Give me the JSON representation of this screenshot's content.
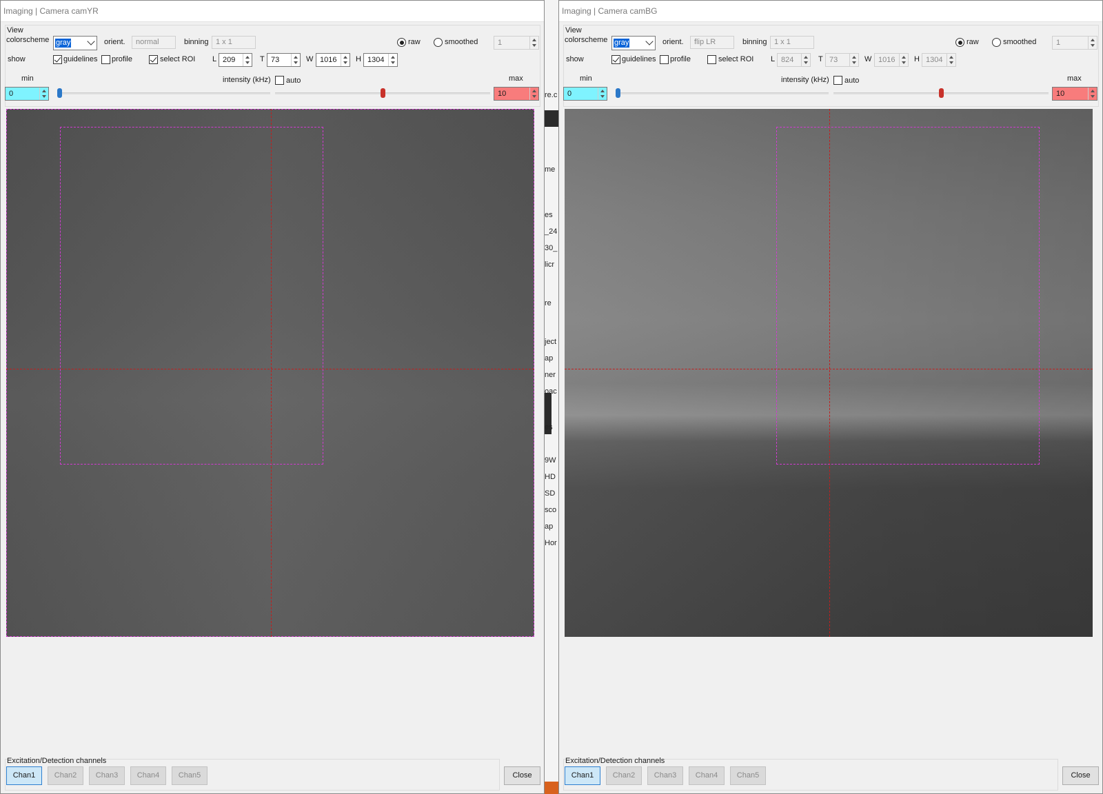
{
  "background_strip": {
    "items": [
      "re.c",
      "me",
      "es",
      "_24",
      "30_",
      "licr",
      "re",
      "ject",
      "ap",
      "ner",
      "oac",
      "es",
      "9W",
      "HD",
      "SD",
      "sco",
      "ap",
      "Hor"
    ]
  },
  "windows": [
    {
      "title": "Imaging | Camera camYR",
      "view_label": "View",
      "colorscheme_label": "colorscheme",
      "colorscheme_value": "gray",
      "orient_label": "orient.",
      "orient_value": "normal",
      "binning_label": "binning",
      "binning_value": "1 x 1",
      "raw_label": "raw",
      "smoothed_label": "smoothed",
      "smooth_value": "1",
      "raw_selected": true,
      "show_label": "show",
      "guidelines_label": "guidelines",
      "guidelines_checked": true,
      "profile_label": "profile",
      "profile_checked": false,
      "select_roi_label": "select ROI",
      "select_roi_checked": true,
      "roi": {
        "L_label": "L",
        "L": "209",
        "T_label": "T",
        "T": "73",
        "W_label": "W",
        "W": "1016",
        "H_label": "H",
        "H": "1304",
        "enabled": true
      },
      "min_label": "min",
      "max_label": "max",
      "intensity_label": "intensity (kHz)",
      "auto_label": "auto",
      "auto_checked": false,
      "min_value": "0",
      "max_value": "10",
      "channels_label": "Excitation/Detection channels",
      "channels": [
        "Chan1",
        "Chan2",
        "Chan3",
        "Chan4",
        "Chan5"
      ],
      "active_channel": "Chan1",
      "close_label": "Close"
    },
    {
      "title": "Imaging | Camera camBG",
      "view_label": "View",
      "colorscheme_label": "colorscheme",
      "colorscheme_value": "gray",
      "orient_label": "orient.",
      "orient_value": "flip LR",
      "binning_label": "binning",
      "binning_value": "1 x 1",
      "raw_label": "raw",
      "smoothed_label": "smoothed",
      "smooth_value": "1",
      "raw_selected": true,
      "show_label": "show",
      "guidelines_label": "guidelines",
      "guidelines_checked": true,
      "profile_label": "profile",
      "profile_checked": false,
      "select_roi_label": "select ROI",
      "select_roi_checked": false,
      "roi": {
        "L_label": "L",
        "L": "824",
        "T_label": "T",
        "T": "73",
        "W_label": "W",
        "W": "1016",
        "H_label": "H",
        "H": "1304",
        "enabled": false
      },
      "min_label": "min",
      "max_label": "max",
      "intensity_label": "intensity (kHz)",
      "auto_label": "auto",
      "auto_checked": false,
      "min_value": "0",
      "max_value": "10",
      "channels_label": "Excitation/Detection channels",
      "channels": [
        "Chan1",
        "Chan2",
        "Chan3",
        "Chan4",
        "Chan5"
      ],
      "active_channel": "Chan1",
      "close_label": "Close"
    }
  ],
  "colors": {
    "min_field": "#7ff3ff",
    "max_field": "#f87c7c",
    "guideline": "#c21e1e",
    "roi": "#d23ad2",
    "active_channel": "#cde7f7"
  }
}
